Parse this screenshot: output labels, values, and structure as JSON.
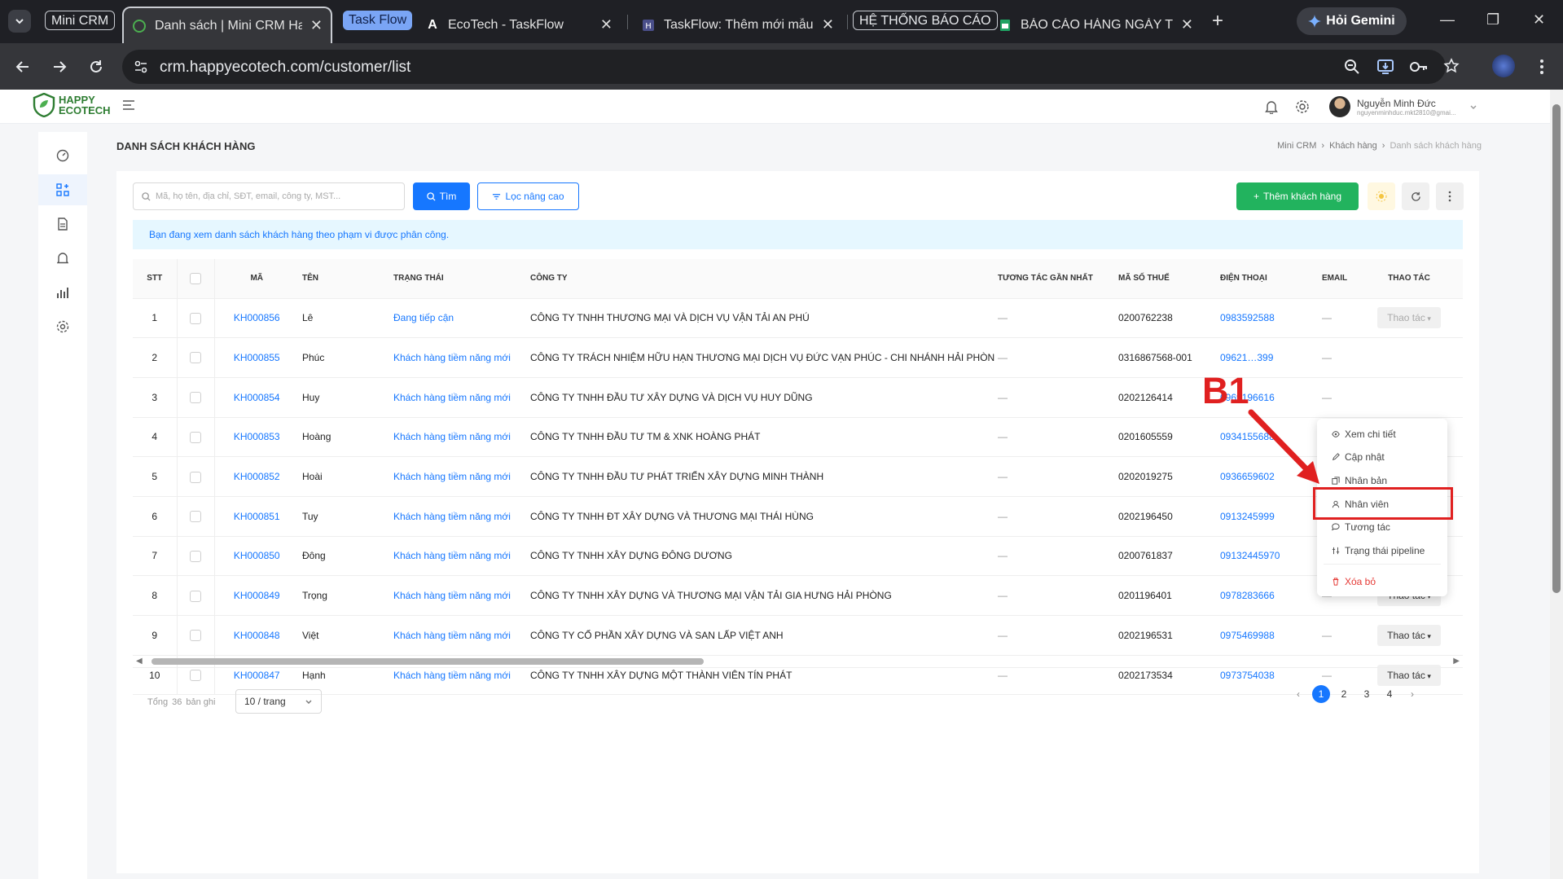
{
  "browser": {
    "tab_groups": [
      "Mini CRM",
      "Task Flow",
      "HỆ THỐNG BÁO CÁO"
    ],
    "tabs": [
      {
        "title": "Danh sách | Mini CRM Hap"
      },
      {
        "title": "EcoTech - TaskFlow"
      },
      {
        "title": "TaskFlow: Thêm mới mẫu c"
      },
      {
        "title": "BÁO CÁO HÀNG NGÀY TE"
      }
    ],
    "gemini_label": "Hỏi Gemini",
    "url": "crm.happyecotech.com/customer/list"
  },
  "app": {
    "logo_line1": "HAPPY",
    "logo_line2": "ECOTECH",
    "user_name": "Nguyễn Minh Đức",
    "user_email": "nguyenminhduc.mkt2810@gmai..."
  },
  "page": {
    "title": "DANH SÁCH KHÁCH HÀNG",
    "breadcrumb": [
      "Mini CRM",
      "Khách hàng",
      "Danh sách khách hàng"
    ],
    "search_placeholder": "Mã, họ tên, địa chỉ, SĐT, email, công ty, MST...",
    "find_label": "Tìm",
    "filter_label": "Lọc nâng cao",
    "add_label": "Thêm khách hàng",
    "notice": "Bạn đang xem danh sách khách hàng theo phạm vi được phân công."
  },
  "table": {
    "headers": [
      "STT",
      "MÃ",
      "TÊN",
      "TRẠNG THÁI",
      "CÔNG TY",
      "TƯƠNG TÁC GẦN NHẤT",
      "MÃ SỐ THUẾ",
      "ĐIỆN THOẠI",
      "EMAIL",
      "THAO TÁC"
    ],
    "action_label": "Thao tác",
    "rows": [
      {
        "stt": "1",
        "ma": "KH000856",
        "ten": "Lê",
        "trang_thai": "Đang tiếp cận",
        "cong_ty": "CÔNG TY TNHH THƯƠNG MẠI VÀ DỊCH VỤ VẬN TẢI AN PHÚ",
        "tuong_tac": "—",
        "mst": "0200762238",
        "dien_thoai": "0983592588",
        "email": "—"
      },
      {
        "stt": "2",
        "ma": "KH000855",
        "ten": "Phúc",
        "trang_thai": "Khách hàng tiềm năng mới",
        "cong_ty": "CÔNG TY TRÁCH NHIỆM HỮU HẠN THƯƠNG MẠI DỊCH VỤ ĐỨC VẠN PHÚC - CHI NHÁNH HẢI PHÒNG",
        "tuong_tac": "—",
        "mst": "0316867568-001",
        "dien_thoai": "09621…399",
        "email": "—"
      },
      {
        "stt": "3",
        "ma": "KH000854",
        "ten": "Huy",
        "trang_thai": "Khách hàng tiềm năng mới",
        "cong_ty": "CÔNG TY TNHH ĐẦU TƯ XÂY DỰNG VÀ DỊCH VỤ HUY DŨNG",
        "tuong_tac": "—",
        "mst": "0202126414",
        "dien_thoai": "0969196616",
        "email": "—"
      },
      {
        "stt": "4",
        "ma": "KH000853",
        "ten": "Hoàng",
        "trang_thai": "Khách hàng tiềm năng mới",
        "cong_ty": "CÔNG TY TNHH ĐẦU TƯ TM & XNK HOÀNG PHÁT",
        "tuong_tac": "—",
        "mst": "0201605559",
        "dien_thoai": "0934155688",
        "email": "—"
      },
      {
        "stt": "5",
        "ma": "KH000852",
        "ten": "Hoài",
        "trang_thai": "Khách hàng tiềm năng mới",
        "cong_ty": "CÔNG TY TNHH ĐẦU TƯ PHÁT TRIỂN XÂY DỰNG MINH THÀNH",
        "tuong_tac": "—",
        "mst": "0202019275",
        "dien_thoai": "0936659602",
        "email": "—"
      },
      {
        "stt": "6",
        "ma": "KH000851",
        "ten": "Tuy",
        "trang_thai": "Khách hàng tiềm năng mới",
        "cong_ty": "CÔNG TY TNHH ĐT XÂY DỰNG VÀ THƯƠNG MẠI THÁI HÙNG",
        "tuong_tac": "—",
        "mst": "0202196450",
        "dien_thoai": "0913245999",
        "email": "—"
      },
      {
        "stt": "7",
        "ma": "KH000850",
        "ten": "Đông",
        "trang_thai": "Khách hàng tiềm năng mới",
        "cong_ty": "CÔNG TY TNHH XÂY DỰNG ĐÔNG DƯƠNG",
        "tuong_tac": "—",
        "mst": "0200761837",
        "dien_thoai": "09132445970",
        "email": "—"
      },
      {
        "stt": "8",
        "ma": "KH000849",
        "ten": "Trọng",
        "trang_thai": "Khách hàng tiềm năng mới",
        "cong_ty": "CÔNG TY TNHH XÂY DỰNG VÀ THƯƠNG MẠI VẬN TẢI GIA HƯNG HẢI PHÒNG",
        "tuong_tac": "—",
        "mst": "0201196401",
        "dien_thoai": "0978283666",
        "email": "—"
      },
      {
        "stt": "9",
        "ma": "KH000848",
        "ten": "Việt",
        "trang_thai": "Khách hàng tiềm năng mới",
        "cong_ty": "CÔNG TY CỔ PHẦN XÂY DỰNG VÀ SAN LẤP VIỆT ANH",
        "tuong_tac": "—",
        "mst": "0202196531",
        "dien_thoai": "0975469988",
        "email": "—"
      },
      {
        "stt": "10",
        "ma": "KH000847",
        "ten": "Hạnh",
        "trang_thai": "Khách hàng tiềm năng mới",
        "cong_ty": "CÔNG TY TNHH XÂY DỰNG MỘT THÀNH VIÊN TÍN PHÁT",
        "tuong_tac": "—",
        "mst": "0202173534",
        "dien_thoai": "0973754038",
        "email": "—"
      }
    ]
  },
  "footer": {
    "total_prefix": "Tổng",
    "total_count": "36",
    "total_suffix": "bản ghi",
    "page_size": "10 / trang",
    "pages": [
      "1",
      "2",
      "3",
      "4"
    ],
    "current_page": "1"
  },
  "menu": {
    "items": [
      "Xem chi tiết",
      "Cập nhật",
      "Nhân bản",
      "Nhân viên",
      "Tương tác",
      "Trạng thái pipeline"
    ],
    "delete_label": "Xóa bỏ",
    "highlighted": "Nhân viên"
  },
  "annotation": {
    "label": "B1",
    "color": "#e02020"
  },
  "colors": {
    "primary": "#1677ff",
    "success": "#22b35e",
    "danger": "#e53935"
  }
}
